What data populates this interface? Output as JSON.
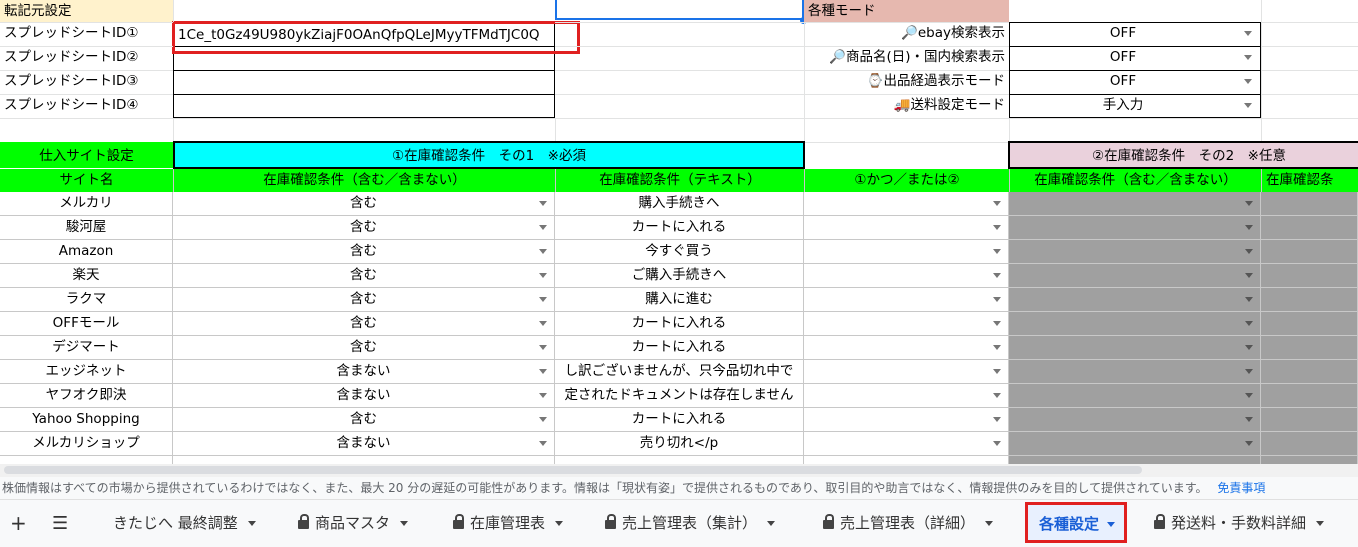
{
  "header_cells": {
    "transfer_source": "転記元設定",
    "modes_title": "各種モード",
    "sheet_ids": [
      "スプレッドシートID①",
      "スプレッドシートID②",
      "スプレッドシートID③",
      "スプレッドシートID④"
    ],
    "sheet_id_value": "1Ce_t0Gz49U980ykZiajF0OAnQfpQLeJMyyTFMdTJC0Q"
  },
  "modes": [
    {
      "label": "🔎ebay検索表示",
      "value": "OFF"
    },
    {
      "label": "🔎商品名(日)・国内検索表示",
      "value": "OFF"
    },
    {
      "label": "⌚出品経過表示モード",
      "value": "OFF"
    },
    {
      "label": "🚚送料設定モード",
      "value": "手入力"
    }
  ],
  "section": {
    "purchase_site_settings": "仕入サイト設定",
    "condition1_title": "①在庫確認条件　その1　※必須",
    "condition2_title": "②在庫確認条件　その2　※任意"
  },
  "columns": {
    "site_name": "サイト名",
    "cond_include": "在庫確認条件（含む／含まない）",
    "cond_text": "在庫確認条件（テキスト）",
    "and_or": "①かつ／または②",
    "cond2_include": "在庫確認条件（含む／含まない）",
    "cond2_text": "在庫確認条"
  },
  "rows": [
    {
      "site": "メルカリ",
      "include": "含む",
      "text": "購入手続きへ"
    },
    {
      "site": "駿河屋",
      "include": "含む",
      "text": "カートに入れる"
    },
    {
      "site": "Amazon",
      "include": "含む",
      "text": "今すぐ買う"
    },
    {
      "site": "楽天",
      "include": "含む",
      "text": "ご購入手続きへ"
    },
    {
      "site": "ラクマ",
      "include": "含む",
      "text": "購入に進む"
    },
    {
      "site": "OFFモール",
      "include": "含む",
      "text": "カートに入れる"
    },
    {
      "site": "デジマート",
      "include": "含む",
      "text": "カートに入れる"
    },
    {
      "site": "エッジネット",
      "include": "含まない",
      "text": "し訳ございませんが、只今品切れ中で"
    },
    {
      "site": "ヤフオク即決",
      "include": "含まない",
      "text": "定されたドキュメントは存在しません"
    },
    {
      "site": "Yahoo Shopping",
      "include": "含む",
      "text": "カートに入れる"
    },
    {
      "site": "メルカリショップ",
      "include": "含まない",
      "text": "売り切れ</p"
    }
  ],
  "footer_notice": "株価情報はすべての市場から提供されているわけではなく、また、最大 20 分の遅延の可能性があります。情報は「現状有姿」で提供されるものであり、取引目的や助言ではなく、情報提供のみを目的して提供されています。",
  "disclaimer_link": "免責事項",
  "tabs": [
    {
      "label": "きたじへ 最終調整",
      "locked": false
    },
    {
      "label": "商品マスタ",
      "locked": true
    },
    {
      "label": "在庫管理表",
      "locked": true
    },
    {
      "label": "売上管理表（集計）",
      "locked": true
    },
    {
      "label": "売上管理表（詳細）",
      "locked": true
    },
    {
      "label": "各種設定",
      "locked": false,
      "active": true
    },
    {
      "label": "発送料・手数料詳細",
      "locked": true
    }
  ],
  "colors": {
    "header_yellow": "#fff2cc",
    "mode_pink": "#e6b8af",
    "cyan": "#00ffff",
    "green": "#00ff00",
    "pink_light": "#ead1dc",
    "gray": "#a0a0a0",
    "red_highlight": "#e02020",
    "link_blue": "#1a73e8"
  }
}
